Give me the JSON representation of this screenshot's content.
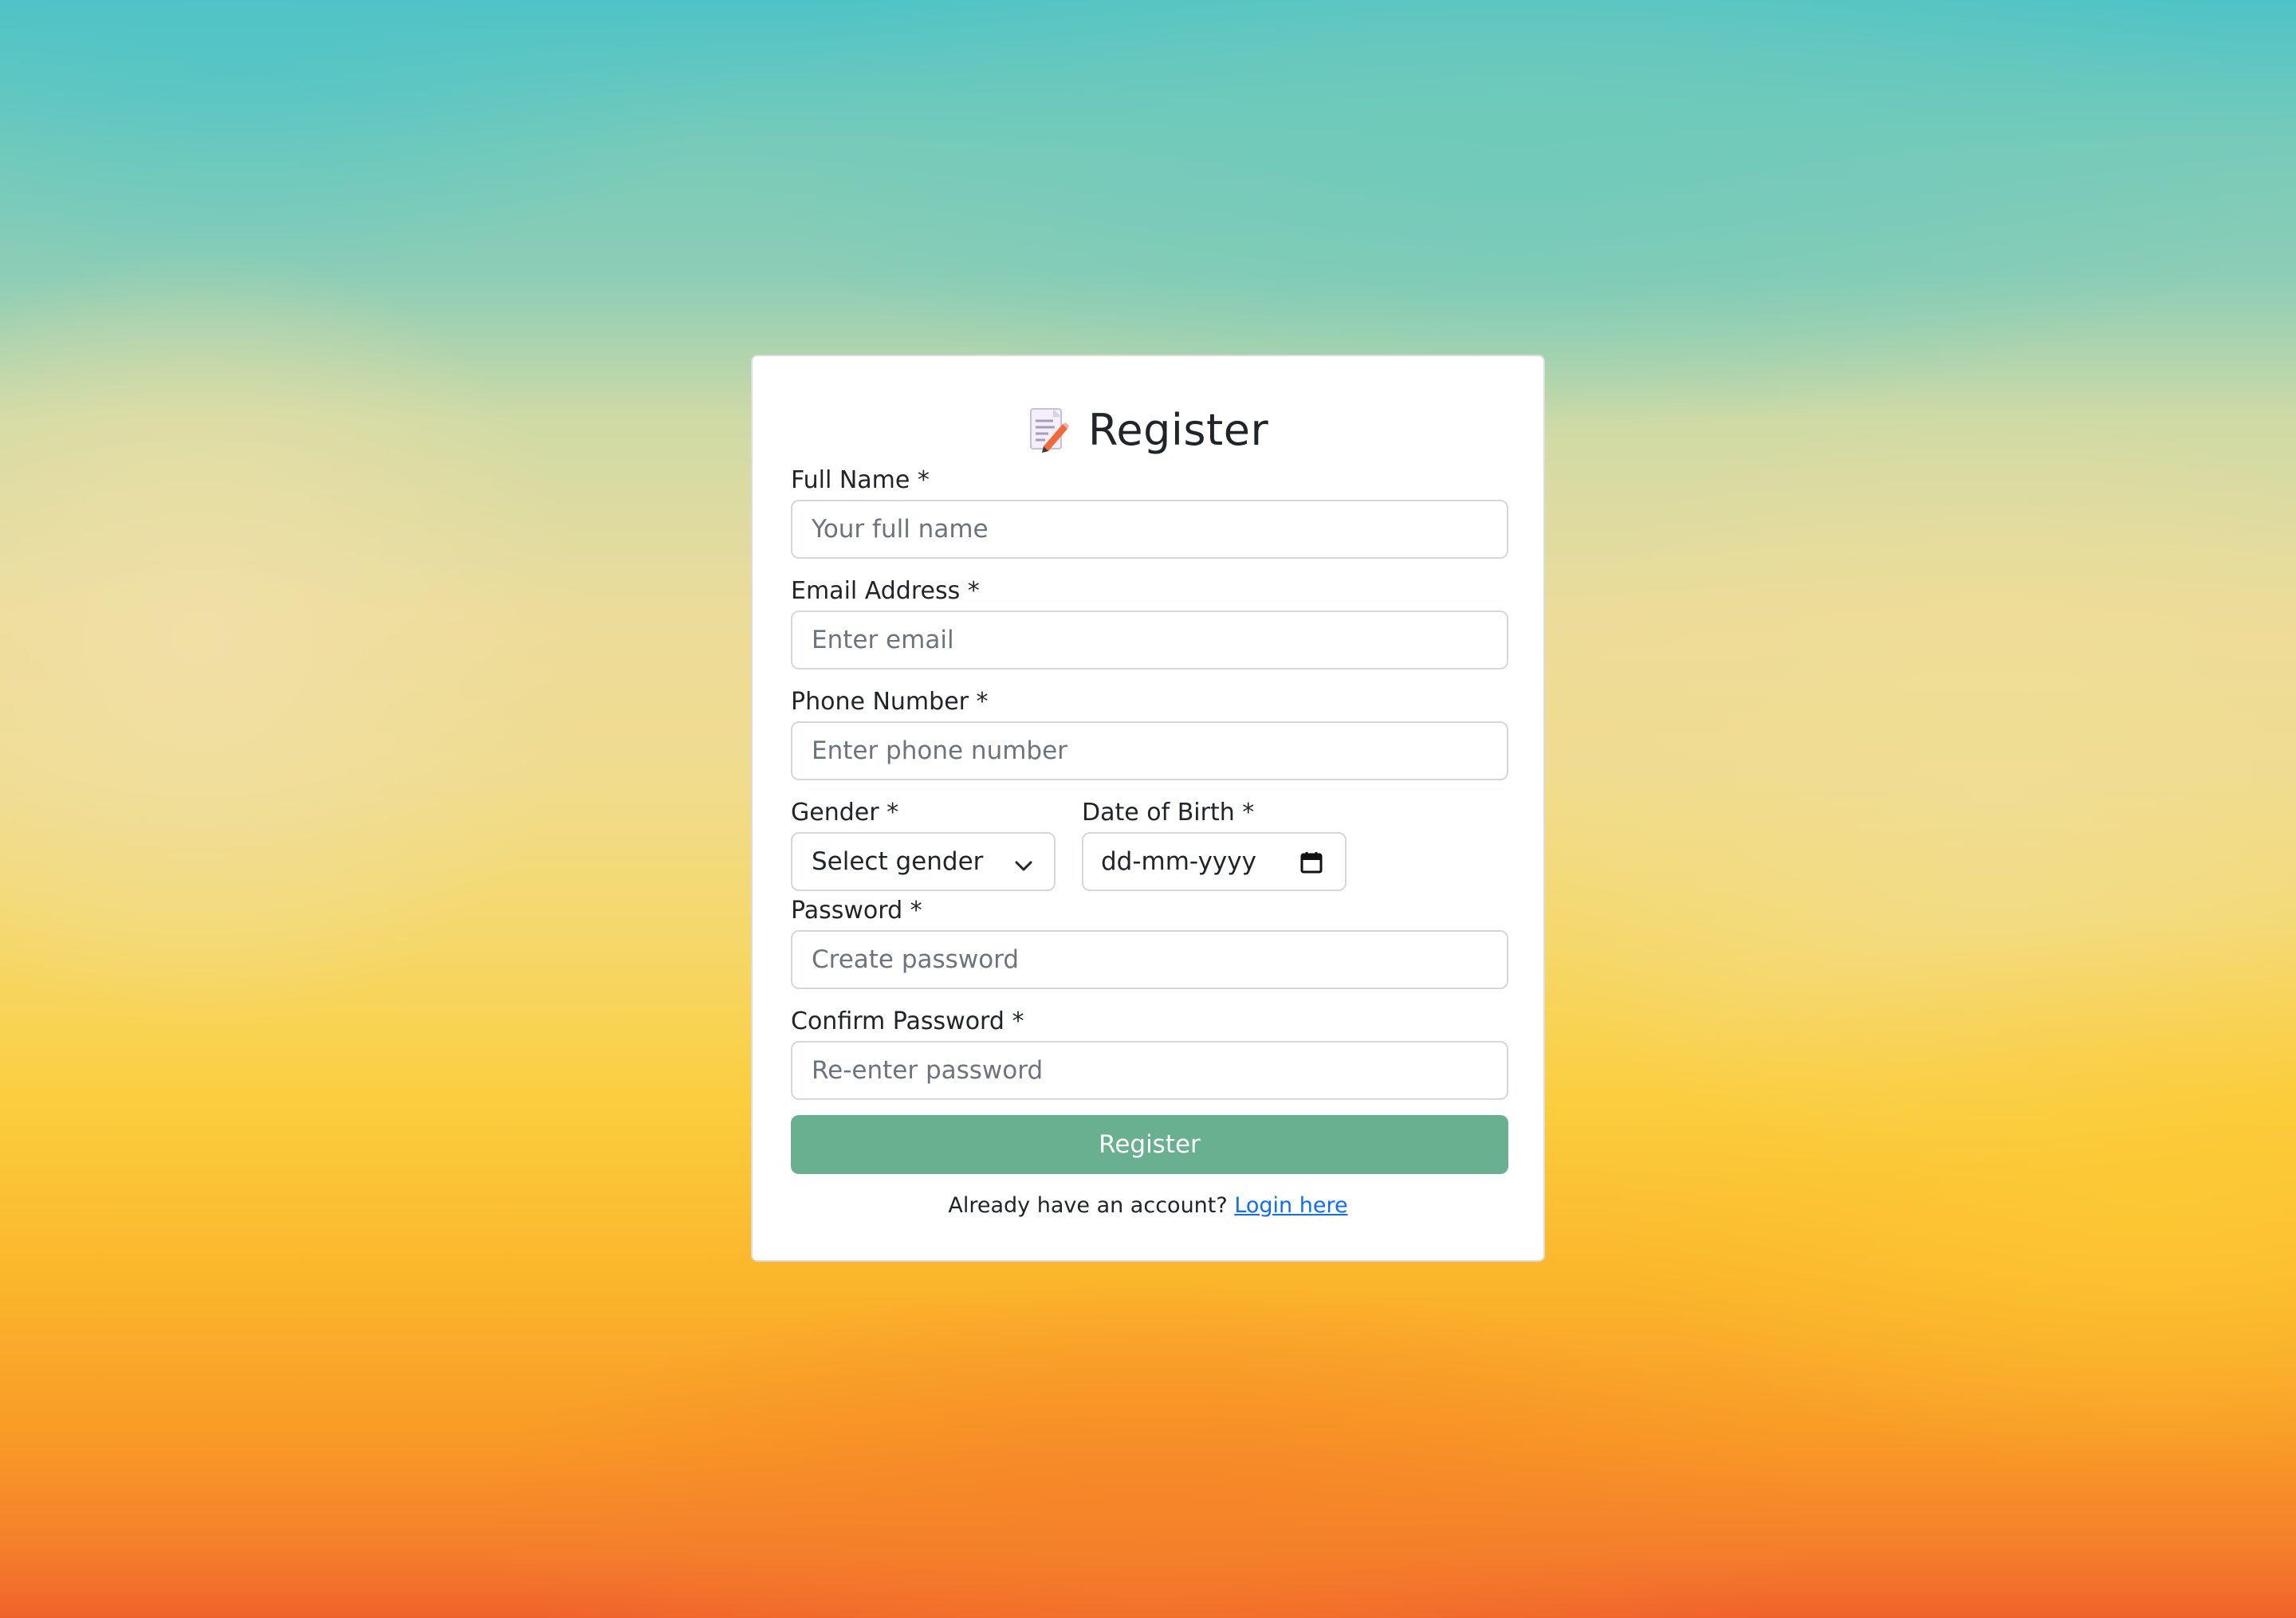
{
  "title": "Register",
  "fields": {
    "full_name": {
      "label": "Full Name *",
      "placeholder": "Your full name"
    },
    "email": {
      "label": "Email Address *",
      "placeholder": "Enter email"
    },
    "phone": {
      "label": "Phone Number *",
      "placeholder": "Enter phone number"
    },
    "gender": {
      "label": "Gender *",
      "selected": "Select gender"
    },
    "dob": {
      "label": "Date of Birth *",
      "placeholder": "dd-mm-yyyy"
    },
    "password": {
      "label": "Password *",
      "placeholder": "Create password"
    },
    "confirm_password": {
      "label": "Confirm Password *",
      "placeholder": "Re-enter password"
    }
  },
  "submit_label": "Register",
  "footer": {
    "prompt": "Already have an account?",
    "link_text": "Login here"
  },
  "colors": {
    "button": "#68b08f",
    "link": "#0d6efd"
  },
  "icons": {
    "title": "memo-icon",
    "gender_select": "chevron-down-icon",
    "dob": "calendar-icon"
  }
}
